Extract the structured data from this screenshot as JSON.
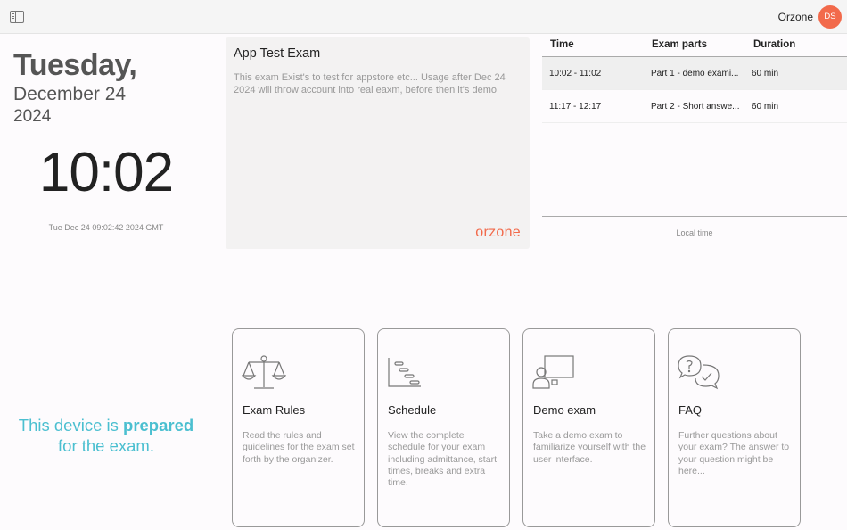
{
  "header": {
    "org_name": "Orzone",
    "avatar_initials": "DS",
    "avatar_color": "#f26a4b"
  },
  "datetime": {
    "weekday": "Tuesday,",
    "month_day": "December 24",
    "year": "2024",
    "clock": "10:02",
    "gmt_string": "Tue Dec 24 09:02:42 2024 GMT"
  },
  "exam": {
    "title": "App Test Exam",
    "description": "This exam Exist's to test for appstore etc... Usage after Dec 24 2024 will throw account into real eaxm, before then it's demo",
    "brand_logo": "orzone",
    "brand_color": "#f26a4b"
  },
  "schedule": {
    "headers": {
      "time": "Time",
      "parts": "Exam parts",
      "duration": "Duration"
    },
    "rows": [
      {
        "time": "10:02 - 11:02",
        "part": "Part 1 - demo exami...",
        "duration": "60 min"
      },
      {
        "time": "11:17 - 12:17",
        "part": "Part 2 - Short answe...",
        "duration": "60 min"
      }
    ],
    "footer": "Local time"
  },
  "status": {
    "prefix": "This device is ",
    "emphasis": "prepared",
    "suffix": "for the exam.",
    "color": "#4bbfd0"
  },
  "tiles": [
    {
      "icon": "scales-icon",
      "title": "Exam Rules",
      "desc": "Read the rules and guidelines for the exam set forth by the organizer."
    },
    {
      "icon": "gantt-chart-icon",
      "title": "Schedule",
      "desc": "View the complete schedule for your exam including admittance, start times, breaks and extra time."
    },
    {
      "icon": "presenter-screen-icon",
      "title": "Demo exam",
      "desc": "Take a demo exam to familiarize yourself with the user interface."
    },
    {
      "icon": "chat-bubbles-icon",
      "title": "FAQ",
      "desc": "Further questions about your exam? The answer to your question might be here..."
    }
  ]
}
